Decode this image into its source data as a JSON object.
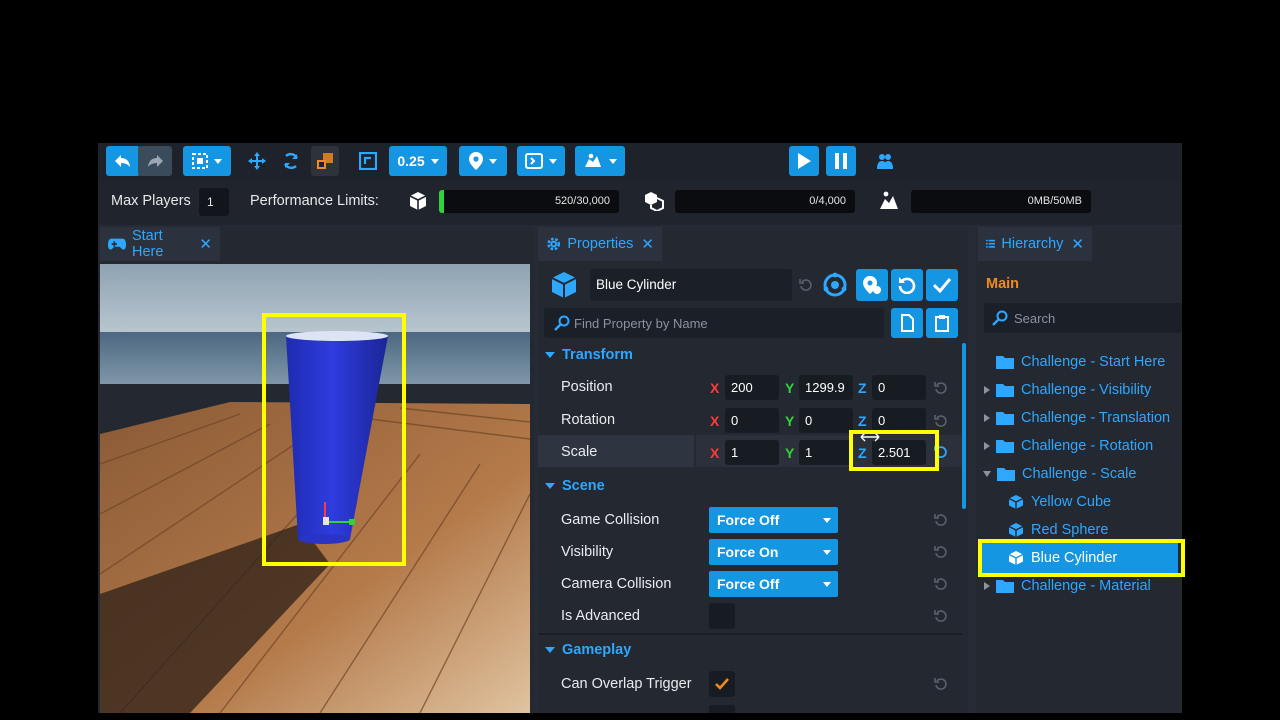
{
  "toolbar": {
    "snap_value": "0.25"
  },
  "infobar": {
    "max_players_label": "Max Players",
    "max_players_value": "1",
    "perf_label": "Performance Limits:",
    "meters": [
      {
        "text": "520/30,000",
        "fraction": 0.017
      },
      {
        "text": "0/4,000",
        "fraction": 0
      },
      {
        "text": "0MB/50MB",
        "fraction": 0
      }
    ]
  },
  "viewport": {
    "tab_label": "Start Here",
    "close": "✕"
  },
  "properties": {
    "tab_label": "Properties",
    "close": "✕",
    "object_name": "Blue Cylinder",
    "search_placeholder": "Find Property by Name",
    "sections": {
      "transform": "Transform",
      "scene": "Scene",
      "gameplay": "Gameplay"
    },
    "position": {
      "label": "Position",
      "x": "200",
      "y": "1299.9",
      "z": "0"
    },
    "rotation": {
      "label": "Rotation",
      "x": "0",
      "y": "0",
      "z": "0"
    },
    "scale": {
      "label": "Scale",
      "x": "1",
      "y": "1",
      "z": "2.501"
    },
    "axis": {
      "x": "X",
      "y": "Y",
      "z": "Z"
    },
    "game_collision": {
      "label": "Game Collision",
      "value": "Force Off"
    },
    "visibility": {
      "label": "Visibility",
      "value": "Force On"
    },
    "camera_collision": {
      "label": "Camera Collision",
      "value": "Force Off"
    },
    "is_advanced": {
      "label": "Is Advanced"
    },
    "can_overlap": {
      "label": "Can Overlap Trigger"
    }
  },
  "hierarchy": {
    "tab_label": "Hierarchy",
    "close": "✕",
    "root": "Main",
    "search_placeholder": "Search",
    "items": [
      {
        "label": "Challenge - Start Here"
      },
      {
        "label": "Challenge - Visibility"
      },
      {
        "label": "Challenge - Translation"
      },
      {
        "label": "Challenge - Rotation"
      },
      {
        "label": "Challenge - Scale"
      },
      {
        "label": "Yellow Cube"
      },
      {
        "label": "Red Sphere"
      },
      {
        "label": "Blue Cylinder"
      },
      {
        "label": "Challenge - Material"
      }
    ]
  },
  "colors": {
    "accent": "#1596e3",
    "highlight": "#ffff00",
    "axis_x": "#ff3b3b",
    "axis_y": "#37d23a",
    "axis_z": "#2ea7ff",
    "meter_fill": "#2fd33b"
  }
}
